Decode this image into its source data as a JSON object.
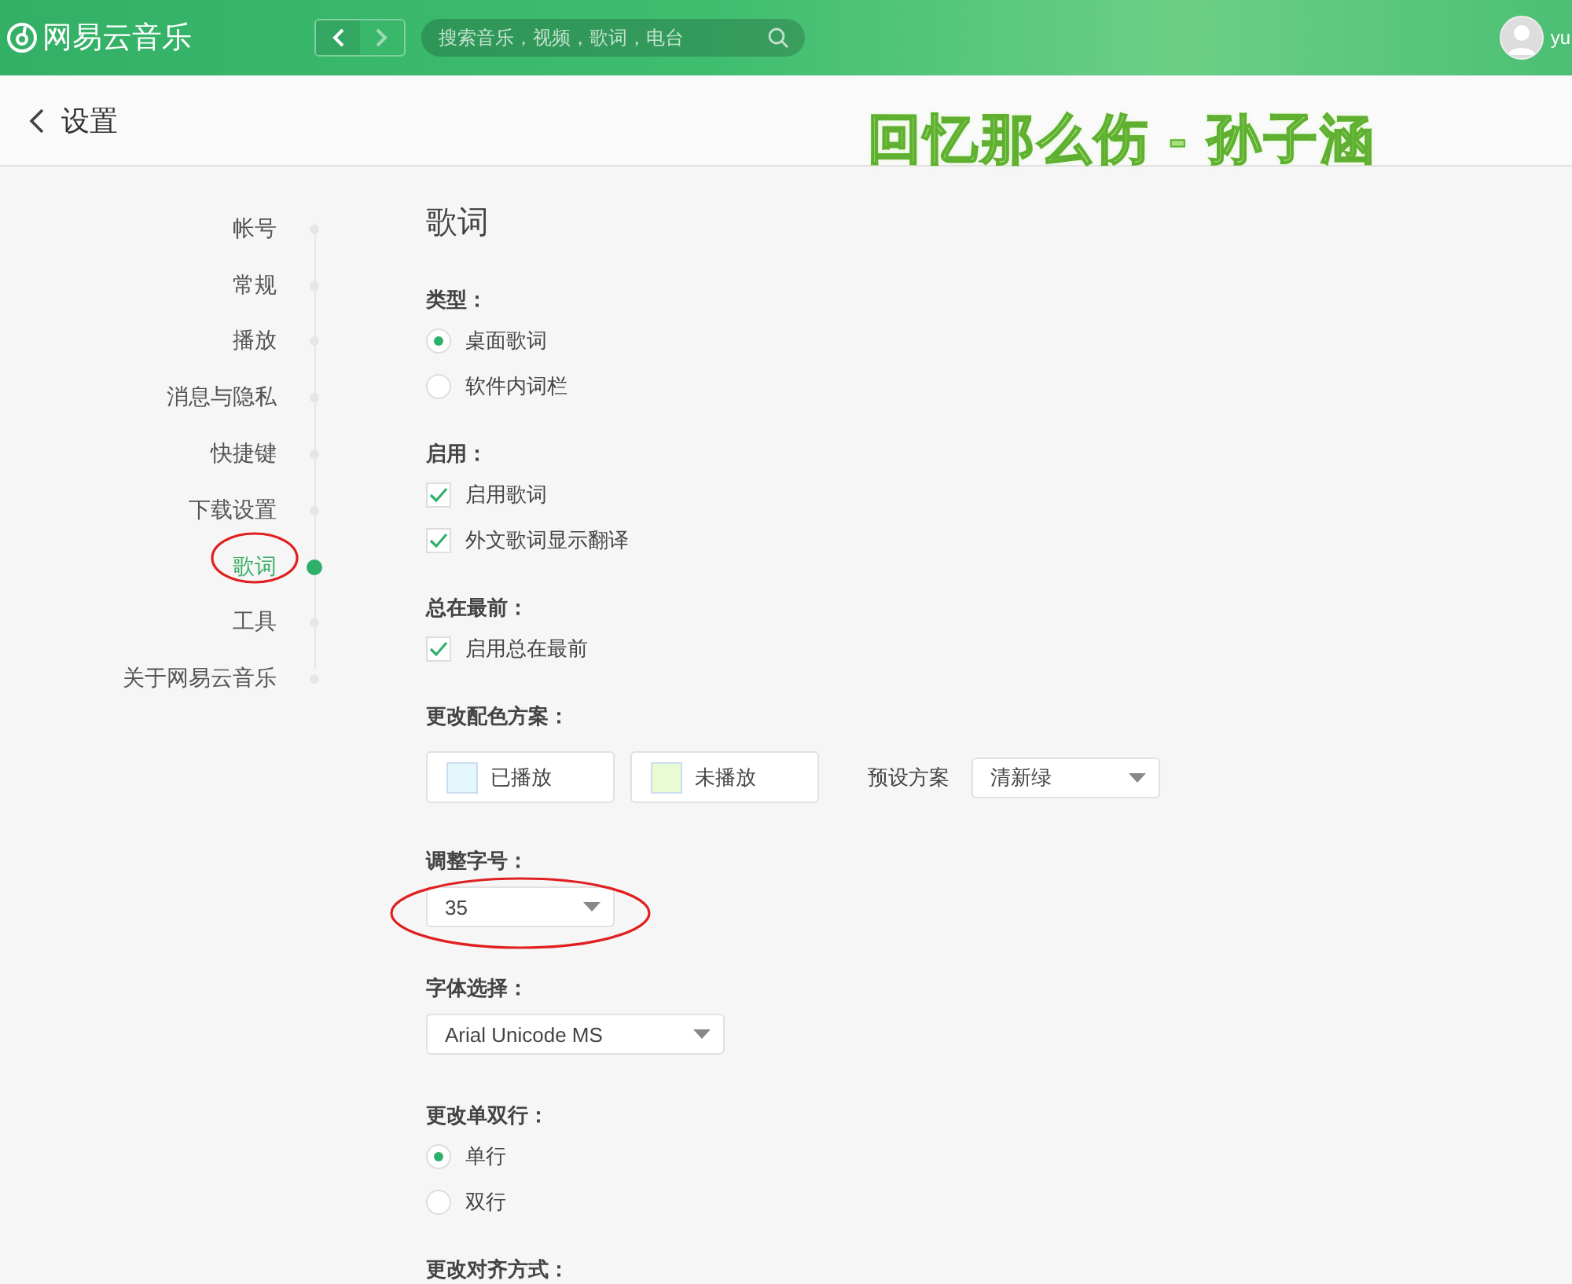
{
  "header": {
    "logo": "网易云音乐",
    "search": {
      "placeholder": "搜索音乐，视频，歌词，电台"
    },
    "user": "yu"
  },
  "page": {
    "title": "设置"
  },
  "desktop_lyrics": "回忆那么伤 - 孙子涵",
  "sidebar": {
    "items": [
      {
        "label": "帐号",
        "selected": false
      },
      {
        "label": "常规",
        "selected": false
      },
      {
        "label": "播放",
        "selected": false
      },
      {
        "label": "消息与隐私",
        "selected": false
      },
      {
        "label": "快捷键",
        "selected": false
      },
      {
        "label": "下载设置",
        "selected": false
      },
      {
        "label": "歌词",
        "selected": true
      },
      {
        "label": "工具",
        "selected": false
      },
      {
        "label": "关于网易云音乐",
        "selected": false
      }
    ]
  },
  "section_title": "歌词",
  "groups": [
    {
      "label": "类型：",
      "kind": "radio",
      "options": [
        {
          "label": "桌面歌词",
          "selected": true
        },
        {
          "label": "软件内词栏",
          "selected": false
        }
      ]
    },
    {
      "label": "启用：",
      "kind": "checkbox",
      "options": [
        {
          "label": "启用歌词",
          "checked": true
        },
        {
          "label": "外文歌词显示翻译",
          "checked": true
        }
      ]
    },
    {
      "label": "总在最前：",
      "kind": "checkbox",
      "options": [
        {
          "label": "启用总在最前",
          "checked": true
        }
      ]
    },
    {
      "label": "更改配色方案：",
      "kind": "colors",
      "swatches": [
        {
          "label": "已播放",
          "color": "#e4f7fb"
        },
        {
          "label": "未播放",
          "color": "#e8fbd2"
        }
      ],
      "preset_label": "预设方案",
      "preset": "清新绿"
    },
    {
      "label": "调整字号：",
      "kind": "select",
      "value": "35"
    },
    {
      "label": "字体选择：",
      "kind": "select",
      "value": "Arial Unicode MS"
    },
    {
      "label": "更改单双行：",
      "kind": "radio",
      "options": [
        {
          "label": "单行",
          "selected": true
        },
        {
          "label": "双行",
          "selected": false
        }
      ]
    },
    {
      "label": "更改对齐方式：",
      "kind": "heading"
    }
  ]
}
